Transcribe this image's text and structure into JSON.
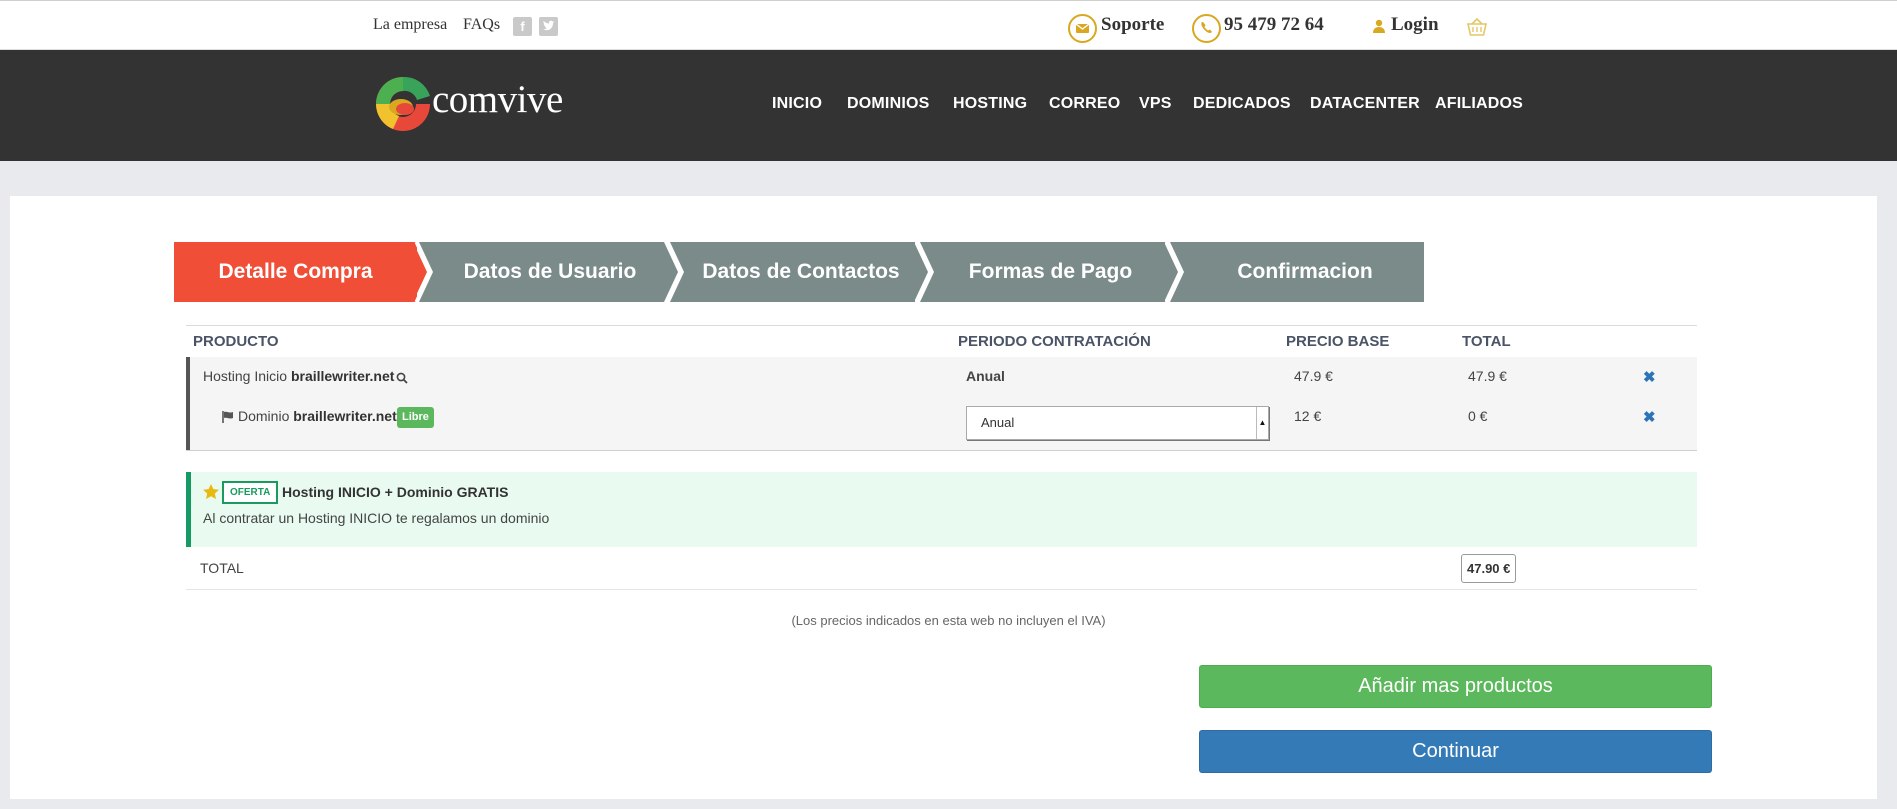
{
  "topbar": {
    "empresa": "La empresa",
    "faqs": "FAQs",
    "soporte": "Soporte",
    "phone": "95 479 72 64",
    "login": "Login"
  },
  "brand": {
    "name": "comvive"
  },
  "nav": [
    "INICIO",
    "DOMINIOS",
    "HOSTING",
    "CORREO",
    "VPS",
    "DEDICADOS",
    "DATACENTER",
    "AFILIADOS"
  ],
  "steps": [
    "Detalle Compra",
    "Datos de Usuario",
    "Datos de Contactos",
    "Formas de Pago",
    "Confirmacion"
  ],
  "table": {
    "headers": [
      "PRODUCTO",
      "PERIODO CONTRATACIÓN",
      "PRECIO BASE",
      "TOTAL"
    ],
    "hosting": {
      "prefix": "Hosting Inicio",
      "domain": "braillewriter.net",
      "period": "Anual",
      "base": "47.9 €",
      "total": "47.9 €"
    },
    "dominio": {
      "prefix": "Dominio",
      "domain": "braillewriter.net",
      "badge": "Libre",
      "period": "Anual",
      "base": "12 €",
      "total": "0 €"
    }
  },
  "offer": {
    "tag": "OFERTA",
    "title": "Hosting INICIO + Dominio GRATIS",
    "desc": "Al contratar un Hosting INICIO te regalamos un dominio"
  },
  "total": {
    "label": "TOTAL",
    "value": "47.90 €"
  },
  "note": "(Los precios indicados en esta web no incluyen el IVA)",
  "buttons": {
    "add": "Añadir mas productos",
    "continue": "Continuar"
  },
  "colors": {
    "active_step": "#f14e38",
    "inactive_step": "#7a8b8a",
    "accent_gold": "#d9a820",
    "green": "#5cb85c",
    "blue": "#337ab7"
  }
}
